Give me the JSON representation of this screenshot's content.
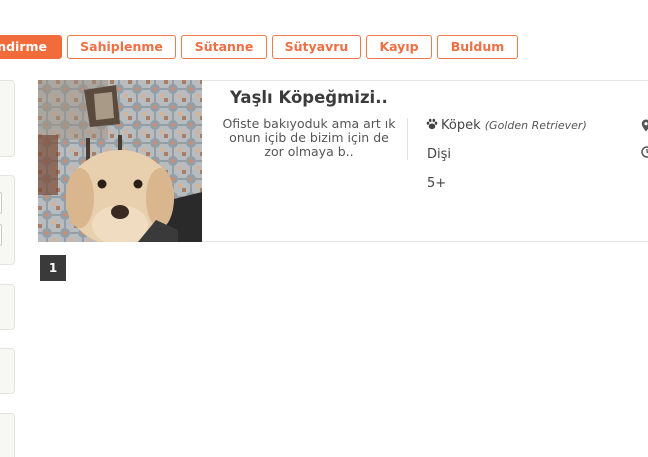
{
  "tabs": [
    {
      "label": "ndirme",
      "active": true
    },
    {
      "label": "Sahiplenme",
      "active": false
    },
    {
      "label": "Sütanne",
      "active": false
    },
    {
      "label": "Sütyavru",
      "active": false
    },
    {
      "label": "Kayıp",
      "active": false
    },
    {
      "label": "Buldum",
      "active": false
    }
  ],
  "listing": {
    "title": "Yaşlı Köpeğmizi..",
    "description": "Ofiste bakıyoduk ama art ık onun içib de bizim için de zor olmaya b..",
    "species": "Köpek",
    "breed": "(Golden Retriever)",
    "gender": "Dişi",
    "age": "5+",
    "species_icon": "paw-icon",
    "location_icon": "map-pin-icon",
    "time_icon": "clock-icon"
  },
  "pagination": {
    "current_page": "1"
  },
  "colors": {
    "accent": "#f26b3a",
    "pager_bg": "#3a3a3a"
  }
}
